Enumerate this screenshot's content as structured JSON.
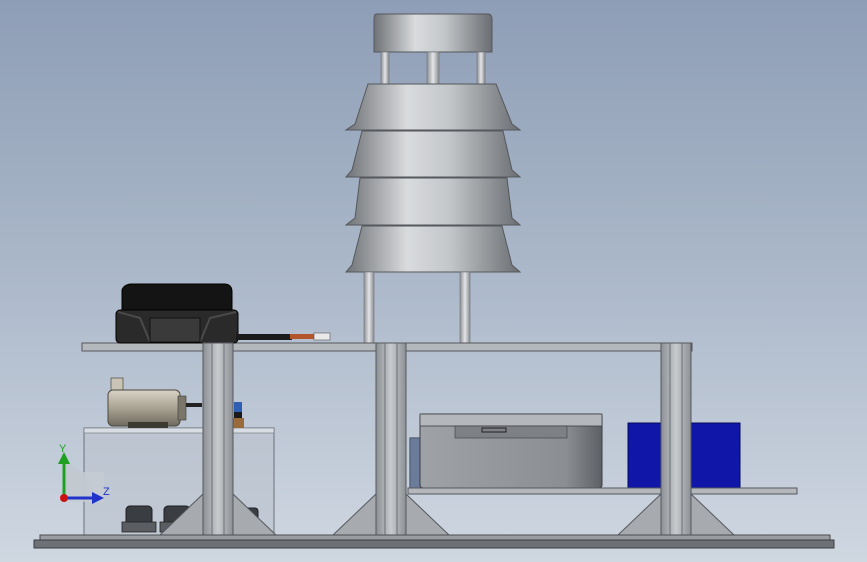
{
  "viewport": {
    "background_top": "#8e9eb6",
    "background_bottom": "#cfd7e1"
  },
  "triad": {
    "y_label": "Y",
    "z_label": "Z",
    "y_color": "#1fa01f",
    "z_color": "#2233cc",
    "origin_color": "#cc1111"
  },
  "model": {
    "frame_color": "#9a9da2",
    "deck_color": "#b4b7bb",
    "enclosure_color": "#5b6e8c",
    "blue_box_color": "#0f16a8",
    "sensor_color": "#111111"
  }
}
